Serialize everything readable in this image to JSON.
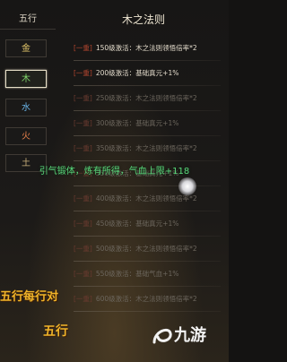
{
  "sidebar": {
    "title": "五行",
    "elements": [
      {
        "label": "金",
        "color": "#e6c96b"
      },
      {
        "label": "木",
        "color": "#7fd36a",
        "selected": true
      },
      {
        "label": "水",
        "color": "#6ab4e8"
      },
      {
        "label": "火",
        "color": "#e8804a"
      },
      {
        "label": "土",
        "color": "#c9b07a"
      }
    ]
  },
  "panel": {
    "title": "木之法则",
    "rows": [
      {
        "tag": "[一重]",
        "text": "150级激活：木之法则领悟倍率*2"
      },
      {
        "tag": "[一重]",
        "text": "200级激活：基础真元+1%"
      },
      {
        "tag": "[一重]",
        "text": "250级激活：木之法则领悟倍率*2"
      },
      {
        "tag": "[一重]",
        "text": "300级激活：基础真元+1%"
      },
      {
        "tag": "[一重]",
        "text": "350级激活：木之法则领悟倍率*2"
      },
      {
        "tag": "[一重]",
        "text": "350级激活：基础真元+1%"
      },
      {
        "tag": "[一重]",
        "text": "400级激活：木之法则领悟倍率*2"
      },
      {
        "tag": "[一重]",
        "text": "450级激活：基础真元+1%"
      },
      {
        "tag": "[一重]",
        "text": "500级激活：木之法则领悟倍率*2"
      },
      {
        "tag": "[一重]",
        "text": "550级激活：基础气血+1%"
      },
      {
        "tag": "[一重]",
        "text": "600级激活：木之法则领悟倍率*2"
      }
    ]
  },
  "notice": {
    "text": "引气锻体，炼有所得，气血上限+118"
  },
  "caption": {
    "line1": "五行每行对",
    "line2": "五行"
  },
  "watermark": {
    "text": "九游"
  }
}
